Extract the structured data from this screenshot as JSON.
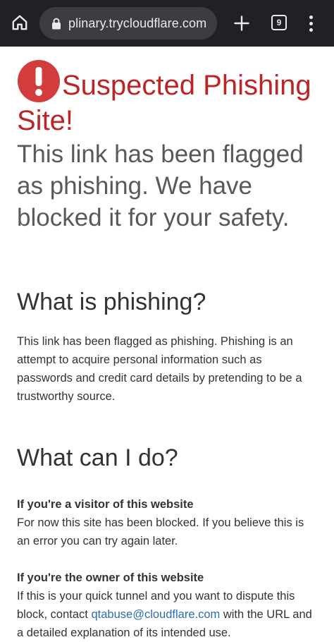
{
  "browser": {
    "url": "plinary.trycloudflare.com",
    "tab_count": "9",
    "icons": {
      "home": "home-icon",
      "lock": "lock-icon",
      "new_tab": "plus-icon",
      "tabs": "tab-switcher-icon",
      "menu": "more-vert-icon"
    }
  },
  "warning": {
    "title": "Suspected Phishing Site!",
    "subtitle": "This link has been flagged as phishing. We have blocked it for your safety.",
    "icon": "exclamation-circle-icon"
  },
  "what_is": {
    "heading": "What is phishing?",
    "body": "This link has been flagged as phishing. Phishing is an attempt to acquire personal information such as passwords and credit card details by pretending to be a trustworthy source."
  },
  "what_can": {
    "heading": "What can I do?",
    "visitor_heading": "If you're a visitor of this website",
    "visitor_body": "For now this site has been blocked. If you believe this is an error you can try again later.",
    "owner_heading": "If you're the owner of this website",
    "owner_body_before": "If this is your quick tunnel and you want to dispute this block, contact ",
    "owner_email": "qtabuse@cloudflare.com",
    "owner_body_after": " with the URL and a detailed explanation of its intended use."
  },
  "colors": {
    "chrome_background": "#202124",
    "url_pill": "#3c3d41",
    "warning_red": "#bd2426",
    "icon_red": "#d33c3c",
    "link_blue": "#2c6cb5",
    "text": "#333333",
    "subtitle_text": "#595959"
  }
}
